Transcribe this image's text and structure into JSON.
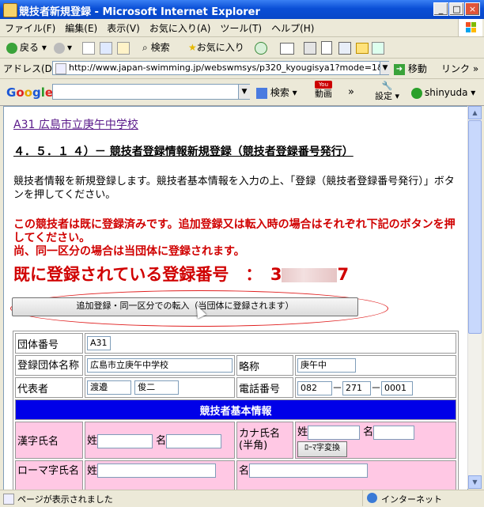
{
  "window": {
    "title": "競技者新規登録 - Microsoft Internet Explorer"
  },
  "menu": [
    "ファイル(F)",
    "編集(E)",
    "表示(V)",
    "お気に入り(A)",
    "ツール(T)",
    "ヘルプ(H)"
  ],
  "toolbar": {
    "back": "戻る",
    "search": "検索",
    "favorites": "お気に入り"
  },
  "address": {
    "label": "アドレス(D)",
    "url": "http://www.japan-swimming.jp/webswmsys/p320_kyougisya1?mode=1&User.",
    "go": "移動",
    "links": "リンク"
  },
  "google": {
    "search": "検索",
    "douga": "動画",
    "settei": "設定",
    "user": "shinyuda"
  },
  "page": {
    "school_link": "A31 広島市立庚午中学校",
    "heading": "４．５．１ ４）－ 競技者登録情報新規登録（競技者登録番号発行）",
    "intro": "競技者情報を新規登録します。競技者基本情報を入力の上、「登録（競技者登録番号発行）」ボタンを押してください。",
    "warning_1": "この競技者は既に登録済みです。追加登録又は転入時の場合はそれぞれ下記のボタンを押してください。",
    "warning_2": "尚、同一区分の場合は当団体に登録されます。",
    "reg_label": "既に登録されている登録番号　：　3",
    "reg_suffix": "7",
    "transfer_button": "追加登録・同一区分での転入（当団体に登録されます）"
  },
  "form": {
    "team_no_label": "団体番号",
    "team_no": "A31",
    "team_name_label": "登録団体名称",
    "team_name": "広島市立庚午中学校",
    "abbr_label": "略称",
    "abbr": "庚午中",
    "rep_label": "代表者",
    "rep_last": "渡邉",
    "rep_first": "俊二",
    "phone_label": "電話番号",
    "phone_1": "082",
    "phone_2": "271",
    "phone_3": "0001",
    "dash": "－",
    "section": "競技者基本情報",
    "kanji_label": "漢字氏名",
    "sei": "姓",
    "mei": "名",
    "kana_label": "カナ氏名(半角)",
    "romaji_button": "ﾛｰﾏ字変換",
    "romaji_label": "ローマ字氏名"
  },
  "status": {
    "text": "ページが表示されました",
    "zone": "インターネット"
  }
}
